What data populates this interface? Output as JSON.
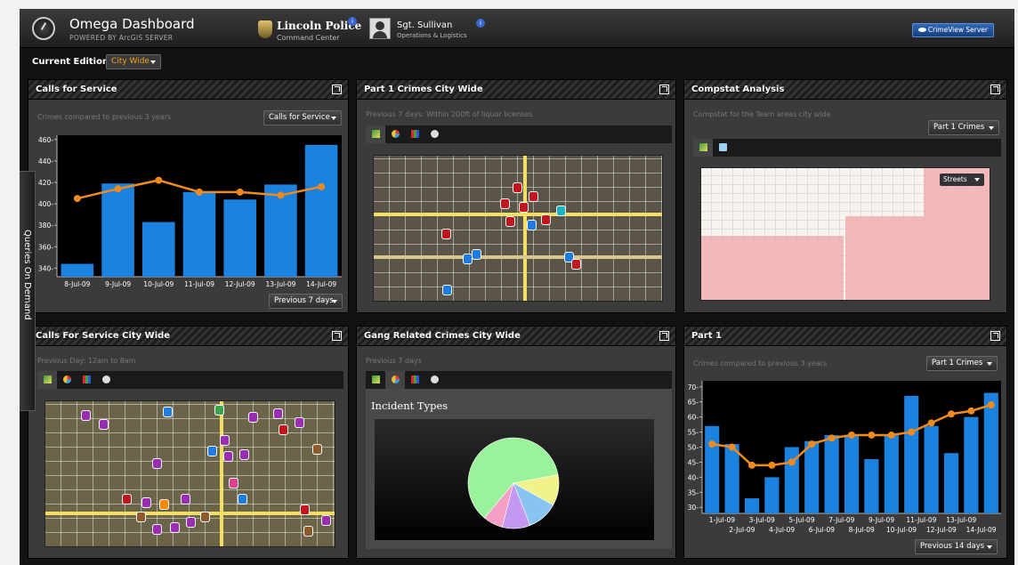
{
  "header": {
    "app_title": "Omega Dashboard",
    "app_subtitle": "POWERED BY ArcGIS SERVER",
    "org_title": "Lincoln Police",
    "org_subtitle": "Command Center",
    "user_name": "Sgt. Sullivan",
    "user_subtitle": "Operations & Logistics",
    "info_glyph": "i",
    "server_button": "CrimeView Server"
  },
  "edition": {
    "label": "Current Edition:",
    "value": "City Wide"
  },
  "side_tab": {
    "label": "Queries On Demand"
  },
  "panels": {
    "calls_for_service": {
      "title": "Calls for Service",
      "subtitle": "Crimes compared to previous 3 years",
      "dropdown": "Calls for Service",
      "footer_dropdown": "Previous 7 days"
    },
    "part1_city": {
      "title": "Part 1 Crimes City Wide",
      "subtitle": "Previous 7 days: Within 200ft of liquor licenses"
    },
    "compstat": {
      "title": "Compstat Analysis",
      "subtitle": "Compstat for the Team areas city wide",
      "dropdown": "Part 1 Crimes",
      "map_button": "Streets"
    },
    "cfs_city": {
      "title": "Calls For Service City Wide",
      "subtitle": "Previous Day: 12am to 8am"
    },
    "gang": {
      "title": "Gang Related Crimes City Wide",
      "subtitle": "Previous 7 days"
    },
    "part1": {
      "title": "Part 1",
      "subtitle": "Crimes compared to previous 3 years",
      "dropdown": "Part 1 Crimes",
      "footer_dropdown": "Previous 14 days"
    }
  },
  "colors": {
    "accent": "#f7a21a",
    "bar": "#1b82e0",
    "line": "#f08a1c"
  },
  "chart_data": [
    {
      "type": "bar",
      "categories": [
        "8-Jul-09",
        "9-Jul-09",
        "10-Jul-09",
        "11-Jul-09",
        "12-Jul-09",
        "13-Jul-09",
        "14-Jul-09"
      ],
      "series": [
        {
          "values": [
            344,
            419,
            383,
            411,
            404,
            418,
            455
          ]
        },
        {
          "values": [
            405,
            414,
            422,
            411,
            411,
            408,
            416
          ]
        }
      ],
      "yticks": [
        340,
        360,
        380,
        400,
        420,
        440,
        460
      ],
      "ylim": [
        332,
        464
      ]
    },
    {
      "type": "pie",
      "title": "Incident Types",
      "values": [
        61,
        11,
        11,
        10,
        7
      ],
      "colors": [
        "#9af39a",
        "#f2f28a",
        "#88c4f2",
        "#c398f0",
        "#f59fc4"
      ]
    },
    {
      "type": "bar",
      "categories": [
        "1-Jul-09",
        "2-Jul-09",
        "3-Jul-09",
        "4-Jul-09",
        "5-Jul-09",
        "6-Jul-09",
        "7-Jul-09",
        "8-Jul-09",
        "9-Jul-09",
        "10-Jul-09",
        "11-Jul-09",
        "12-Jul-09",
        "13-Jul-09",
        "14-Jul-09"
      ],
      "series": [
        {
          "values": [
            57,
            51,
            33,
            40,
            50,
            52,
            54,
            54,
            46,
            54,
            67,
            57,
            48,
            60,
            68
          ]
        },
        {
          "values": [
            51,
            50,
            44,
            44,
            45,
            51,
            53,
            54,
            54,
            54,
            55,
            58,
            61,
            62,
            64
          ]
        }
      ],
      "yticks": [
        30,
        35,
        40,
        45,
        50,
        55,
        60,
        65,
        70
      ],
      "ylim": [
        28,
        72
      ]
    }
  ]
}
